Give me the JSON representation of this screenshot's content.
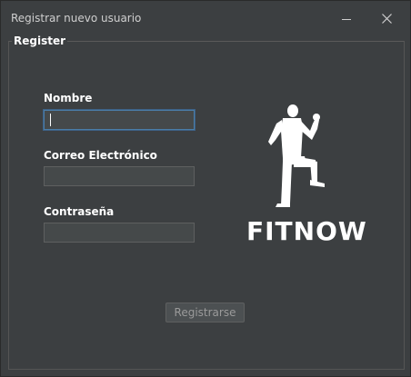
{
  "window": {
    "title": "Registrar nuevo usuario"
  },
  "form": {
    "group_title": "Register",
    "fields": [
      {
        "label": "Nombre",
        "value": "",
        "placeholder": ""
      },
      {
        "label": "Correo Electrónico",
        "value": "",
        "placeholder": ""
      },
      {
        "label": "Contraseña",
        "value": "",
        "placeholder": ""
      }
    ],
    "submit_label": "Registrarse"
  },
  "logo": {
    "text": "FITNOW",
    "icon": "runner-figure-icon"
  },
  "colors": {
    "background": "#3c3f41",
    "input_bg": "#45494a",
    "focus_border": "#4a7da8",
    "text": "#ffffff"
  }
}
